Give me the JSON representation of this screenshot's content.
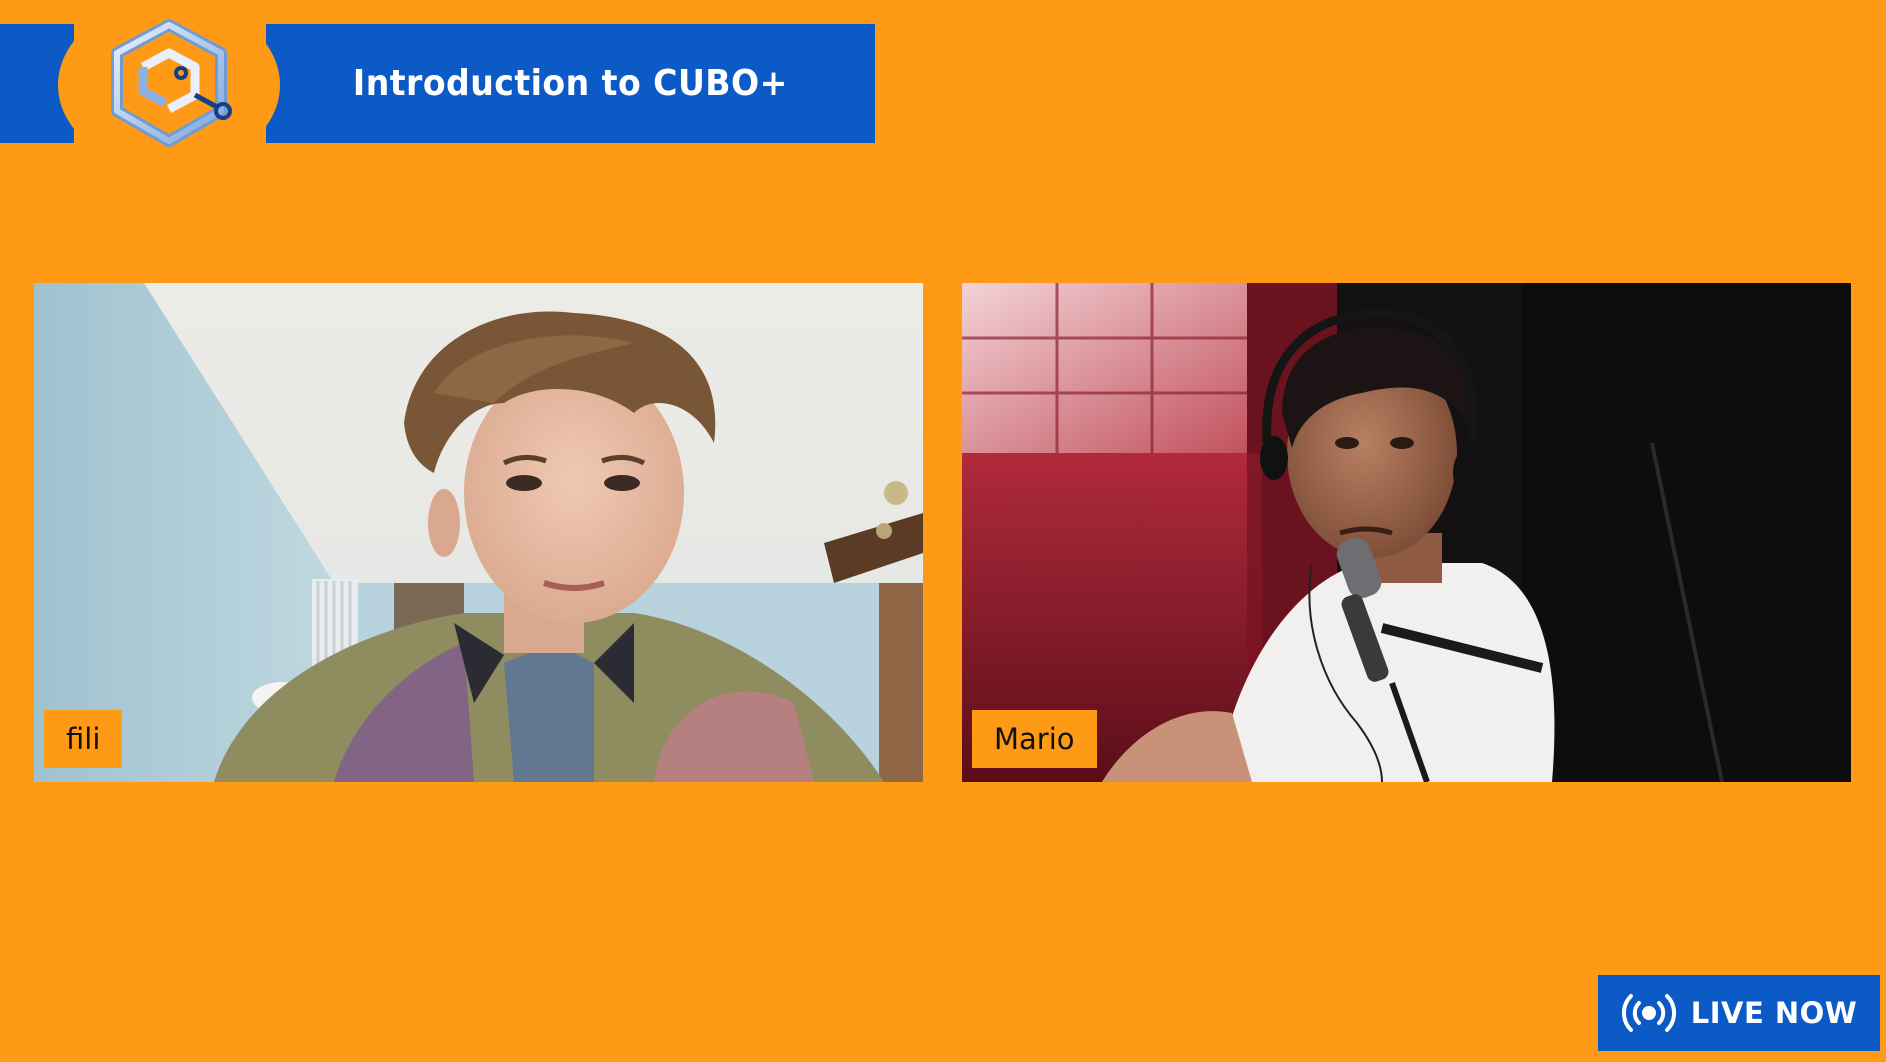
{
  "banner": {
    "title": "Introduction to CUBO+",
    "logo_icon": "cube-circuit-logo-icon"
  },
  "participants": [
    {
      "name": "fili",
      "video": "participant-video-feed"
    },
    {
      "name": "Mario",
      "video": "participant-video-feed"
    }
  ],
  "live_badge": {
    "label": "LIVE NOW",
    "icon": "broadcast-icon"
  },
  "colors": {
    "background": "#FF9A17",
    "banner": "#0C5AC6",
    "name_tag": "#FF9A17",
    "text_light": "#FFFFFF",
    "text_dark": "#111111"
  }
}
